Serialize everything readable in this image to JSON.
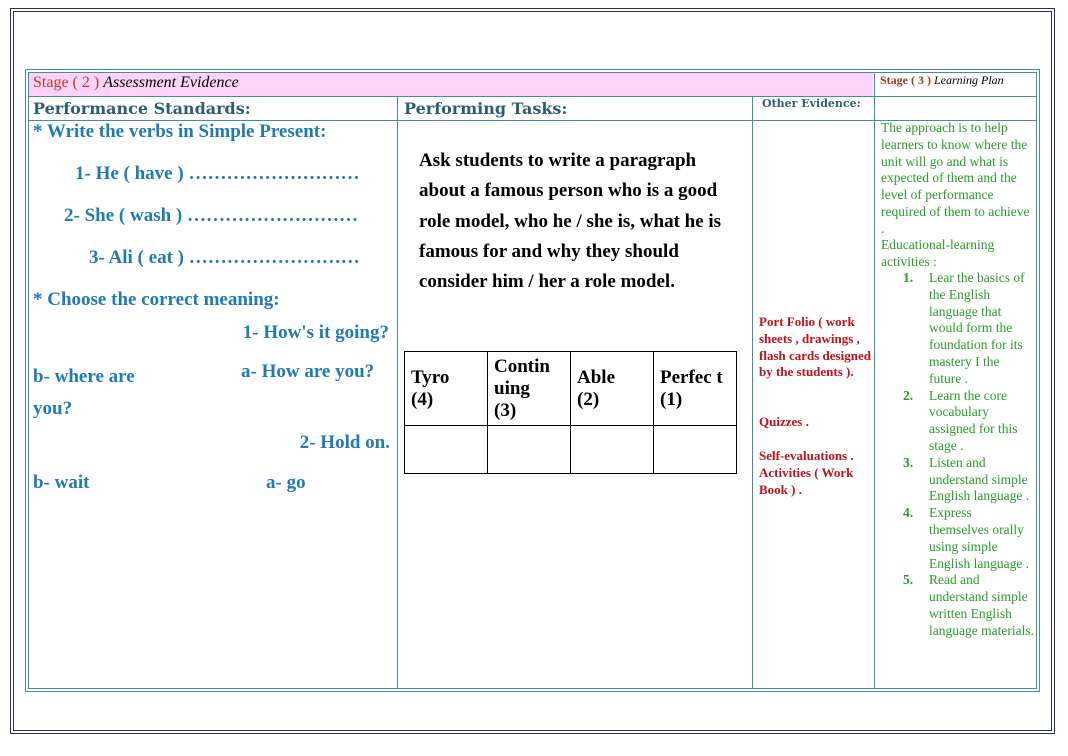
{
  "header": {
    "stage2_prefix": "Stage ( 2 )",
    "stage2_title": "Assessment Evidence",
    "stage3_prefix": "Stage ( 3 )",
    "stage3_title": "Learning Plan"
  },
  "columns": {
    "performance_standards": "Performance Standards:",
    "performing_tasks": "Performing Tasks:",
    "other_evidence": "Other Evidence:"
  },
  "standards": {
    "heading1": "* Write the verbs in Simple Present:",
    "verbs": [
      "1- He ( have ) ………………………",
      "2- She ( wash ) ………………………",
      "3- Ali ( eat ) ………………………"
    ],
    "heading2": "* Choose the correct meaning:",
    "q1": "1- How's it going?",
    "q1_b": "b- where are you?",
    "q1_a": "a- How are you?",
    "q2": "2- Hold on.",
    "q2_b": "b- wait",
    "q2_a": "a- go"
  },
  "tasks": {
    "text": "Ask students to write a paragraph about a famous person who is a good role model, who he / she is, what he is famous for and why they should consider him / her a role model.",
    "rubric_headers": [
      {
        "label": "Tyro",
        "score": "(4)"
      },
      {
        "label": "Contin uing",
        "score": "(3)"
      },
      {
        "label": "Able",
        "score": "(2)"
      },
      {
        "label": "Perfec t",
        "score": "(1)"
      }
    ]
  },
  "evidence": {
    "portfolio": "Port Folio ( work sheets , drawings , flash cards designed by the students ).",
    "quizzes": "Quizzes .",
    "self_eval": "Self-evaluations . Activities ( Work Book ) ."
  },
  "plan": {
    "intro": "The approach is to help learners to know where the unit will go and what is expected of them and the level of performance required of them to achieve .",
    "activities_label": "Educational-learning activities :",
    "items": [
      {
        "num": "1.",
        "text": "Lear the basics of the English language that would form the foundation for its mastery I the future ."
      },
      {
        "num": "2.",
        "text": "Learn the core vocabulary assigned for this stage ."
      },
      {
        "num": "3.",
        "text": "Listen and understand simple English language ."
      },
      {
        "num": "4.",
        "text": "Express themselves orally using simple English language ."
      },
      {
        "num": "5.",
        "text": "Read and understand simple written English language materials."
      }
    ]
  },
  "colors": {
    "header_band": "#fdd3fa",
    "border": "#3f8fa0",
    "blue_text": "#1f7ab5",
    "green_text": "#2a9c2a",
    "red_text": "#c0101a"
  }
}
